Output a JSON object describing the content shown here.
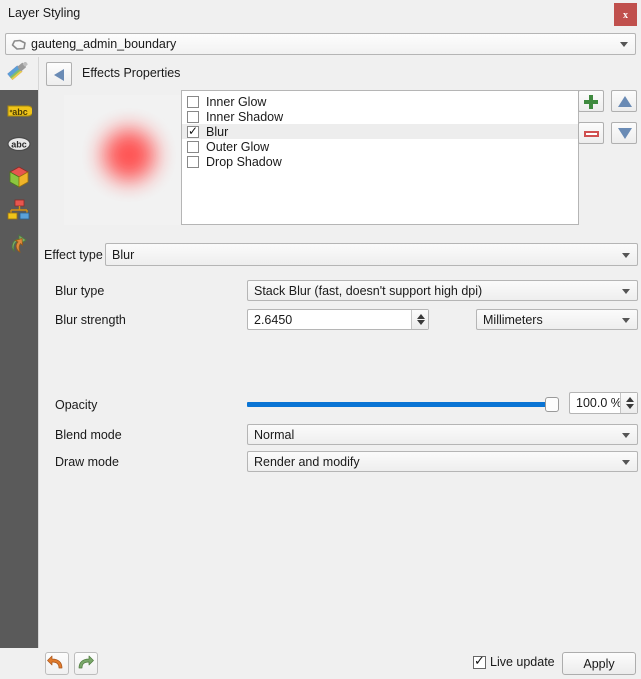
{
  "window": {
    "title": "Layer Styling",
    "close_label": "x"
  },
  "layer_selector": {
    "icon": "polygon-layer-icon",
    "value": "gauteng_admin_boundary"
  },
  "sidebar": {
    "items": [
      {
        "name": "symbology",
        "icon": "paintbrush-icon"
      },
      {
        "name": "labels",
        "icon": "label-abc-icon"
      },
      {
        "name": "masks",
        "icon": "mask-abc-icon"
      },
      {
        "name": "3d-view",
        "icon": "cube-3d-icon"
      },
      {
        "name": "diagrams",
        "icon": "diagram-icon"
      },
      {
        "name": "actions",
        "icon": "action-arrow-icon"
      }
    ]
  },
  "panel": {
    "back_icon": "back-arrow-icon",
    "title": "Effects Properties"
  },
  "effects_list": {
    "items": [
      {
        "label": "Inner Glow",
        "checked": false,
        "selected": false
      },
      {
        "label": "Inner Shadow",
        "checked": false,
        "selected": false
      },
      {
        "label": "Blur",
        "checked": true,
        "selected": true
      },
      {
        "label": "Outer Glow",
        "checked": false,
        "selected": false
      },
      {
        "label": "Drop Shadow",
        "checked": false,
        "selected": false
      }
    ],
    "buttons": [
      {
        "name": "add-effect-button",
        "icon": "plus-icon"
      },
      {
        "name": "remove-effect-button",
        "icon": "minus-icon"
      },
      {
        "name": "move-up-button",
        "icon": "triangle-up-icon"
      },
      {
        "name": "move-down-button",
        "icon": "triangle-down-icon"
      }
    ]
  },
  "preview": {
    "shape": "blurred-red-circle",
    "color": "#ff4a4a"
  },
  "effect_type": {
    "label": "Effect type",
    "value": "Blur"
  },
  "form": {
    "blur_type": {
      "label": "Blur type",
      "value": "Stack Blur (fast, doesn't support high dpi)"
    },
    "blur_strength": {
      "label": "Blur strength",
      "value": "2.6450",
      "unit": "Millimeters"
    },
    "opacity": {
      "label": "Opacity",
      "value": "100.0 %",
      "percent": 100
    },
    "blend_mode": {
      "label": "Blend mode",
      "value": "Normal"
    },
    "draw_mode": {
      "label": "Draw mode",
      "value": "Render and modify"
    }
  },
  "footer": {
    "undo_icon": "undo-arrow-icon",
    "redo_icon": "redo-arrow-icon",
    "live_update_label": "Live update",
    "live_update_checked": true,
    "apply_label": "Apply"
  },
  "colors": {
    "close_red": "#c0504d",
    "slider_blue": "#0a74d4",
    "rail_gray": "#5a5a5a",
    "accent_triangle": "#6a8bb5"
  }
}
